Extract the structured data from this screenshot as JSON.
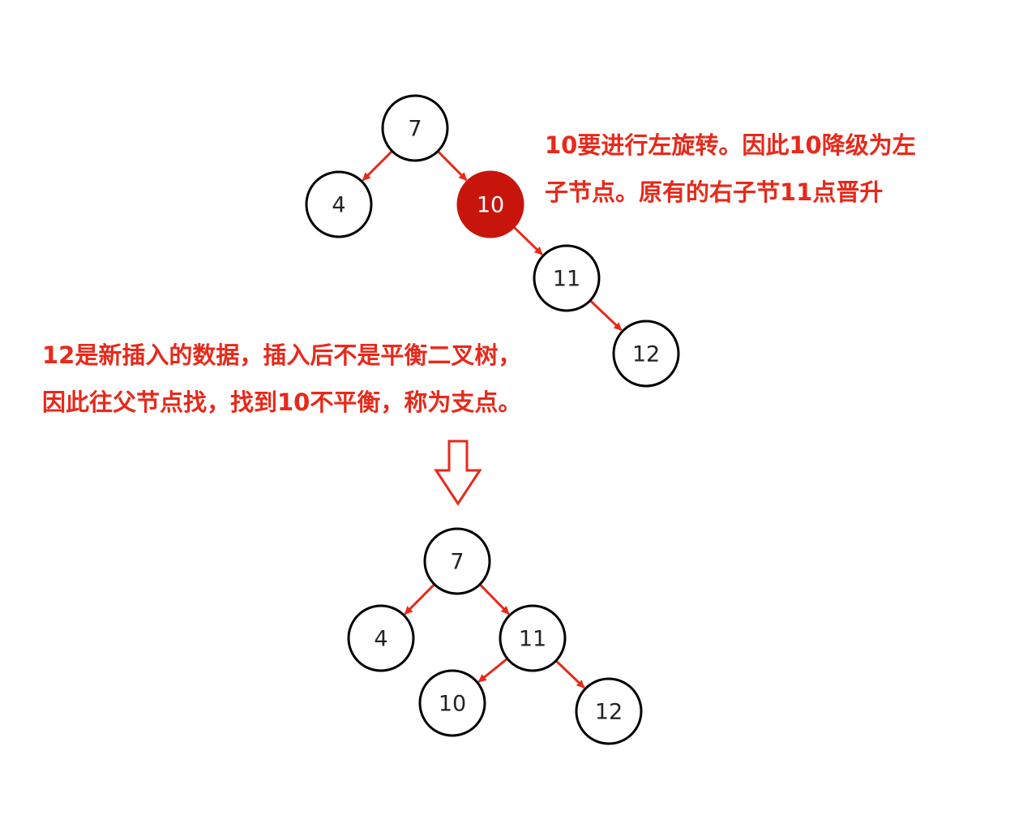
{
  "colors": {
    "accent": "#e8291a",
    "pivot_fill": "#c8150c",
    "node_stroke": "#000000",
    "node_fill": "#ffffff"
  },
  "trees": {
    "before": {
      "nodes": [
        {
          "id": "b7",
          "label": "7",
          "pivot": false
        },
        {
          "id": "b4",
          "label": "4",
          "pivot": false
        },
        {
          "id": "b10",
          "label": "10",
          "pivot": true
        },
        {
          "id": "b11",
          "label": "11",
          "pivot": false
        },
        {
          "id": "b12",
          "label": "12",
          "pivot": false
        }
      ],
      "edges": [
        [
          "b7",
          "b4"
        ],
        [
          "b7",
          "b10"
        ],
        [
          "b10",
          "b11"
        ],
        [
          "b11",
          "b12"
        ]
      ]
    },
    "after": {
      "nodes": [
        {
          "id": "a7",
          "label": "7",
          "pivot": false
        },
        {
          "id": "a4",
          "label": "4",
          "pivot": false
        },
        {
          "id": "a11",
          "label": "11",
          "pivot": false
        },
        {
          "id": "a10",
          "label": "10",
          "pivot": false
        },
        {
          "id": "a12",
          "label": "12",
          "pivot": false
        }
      ],
      "edges": [
        [
          "a7",
          "a4"
        ],
        [
          "a7",
          "a11"
        ],
        [
          "a11",
          "a10"
        ],
        [
          "a11",
          "a12"
        ]
      ]
    }
  },
  "annotations": {
    "rotation_note": {
      "line1": "10要进行左旋转。因此10降级为左",
      "line2": "子节点。原有的右子节11点晋升"
    },
    "insert_note": {
      "line1": "12是新插入的数据，插入后不是平衡二叉树，",
      "line2": "因此往父节点找，找到10不平衡，称为支点。"
    }
  },
  "transition_arrow": {
    "icon": "down-arrow-icon",
    "direction": "down"
  }
}
